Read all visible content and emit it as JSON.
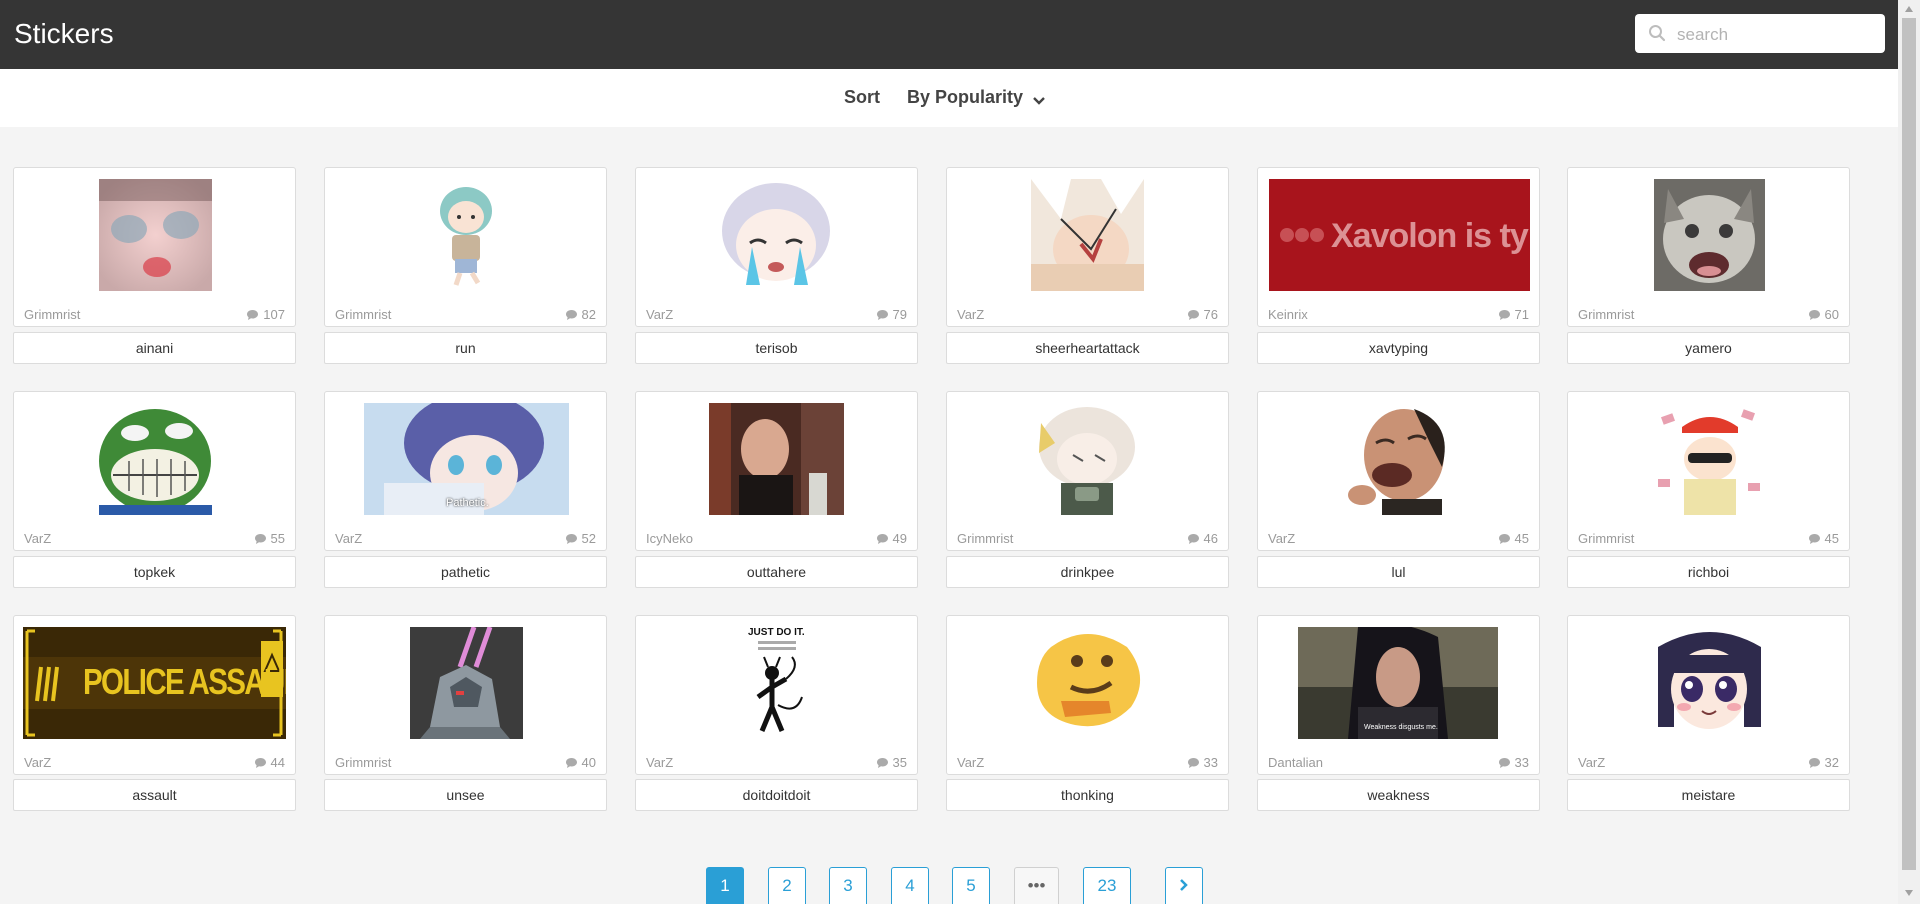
{
  "header": {
    "title": "Stickers",
    "search_placeholder": "search",
    "search_value": ""
  },
  "sort": {
    "label": "Sort",
    "selected": "By Popularity"
  },
  "stickers": [
    {
      "author": "Grimmrist",
      "comments": "107",
      "name": "ainani"
    },
    {
      "author": "Grimmrist",
      "comments": "82",
      "name": "run"
    },
    {
      "author": "VarZ",
      "comments": "79",
      "name": "terisob"
    },
    {
      "author": "VarZ",
      "comments": "76",
      "name": "sheerheartattack"
    },
    {
      "author": "Keinrix",
      "comments": "71",
      "name": "xavtyping",
      "image_text": "Xavolon is typing..."
    },
    {
      "author": "Grimmrist",
      "comments": "60",
      "name": "yamero"
    },
    {
      "author": "VarZ",
      "comments": "55",
      "name": "topkek"
    },
    {
      "author": "VarZ",
      "comments": "52",
      "name": "pathetic",
      "image_text": "Pathetic."
    },
    {
      "author": "IcyNeko",
      "comments": "49",
      "name": "outtahere"
    },
    {
      "author": "Grimmrist",
      "comments": "46",
      "name": "drinkpee"
    },
    {
      "author": "VarZ",
      "comments": "45",
      "name": "lul"
    },
    {
      "author": "Grimmrist",
      "comments": "45",
      "name": "richboi"
    },
    {
      "author": "VarZ",
      "comments": "44",
      "name": "assault",
      "image_text": "POLICE ASSAULT IN PRO"
    },
    {
      "author": "Grimmrist",
      "comments": "40",
      "name": "unsee"
    },
    {
      "author": "VarZ",
      "comments": "35",
      "name": "doitdoitdoit",
      "image_text": "JUST DO IT."
    },
    {
      "author": "VarZ",
      "comments": "33",
      "name": "thonking"
    },
    {
      "author": "Dantalian",
      "comments": "33",
      "name": "weakness",
      "image_text": "Weakness disgusts me."
    },
    {
      "author": "VarZ",
      "comments": "32",
      "name": "meistare"
    }
  ],
  "pagination": {
    "pages": [
      "1",
      "2",
      "3",
      "4",
      "5",
      "•••",
      "23"
    ],
    "current": "1"
  },
  "colors": {
    "header_bg": "#353535",
    "accent": "#2a9fd6",
    "page_bg": "#f4f4f4"
  }
}
